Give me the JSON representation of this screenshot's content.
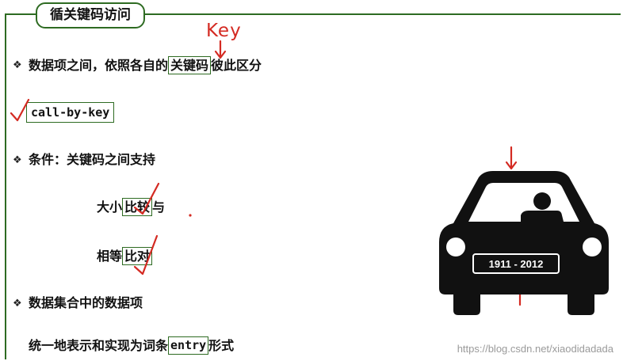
{
  "title": "循关键码访问",
  "bullet_glyph": "❖",
  "section1": {
    "pre": "数据项之间，依照各自的",
    "boxed": "关键码",
    "post": "彼此区分",
    "annotation": "Key"
  },
  "code_label": "call-by-key",
  "section2": {
    "text": "条件：关键码之间支持",
    "compare": {
      "pre": "大小",
      "boxed": "比较",
      "post": "与"
    },
    "equal": {
      "pre": "相等",
      "boxed": "比对"
    }
  },
  "section3": {
    "text": "数据集合中的数据项",
    "sub": {
      "pre": "统一地表示和实现为词条",
      "boxed": "entry",
      "post": "形式"
    }
  },
  "car": {
    "plate": "1911 - 2012",
    "icon": "car-front-icon"
  },
  "watermark": "https://blog.csdn.net/xiaodidadada",
  "colors": {
    "border": "#2e6b22",
    "annotation": "#d42a22",
    "car": "#111111"
  }
}
